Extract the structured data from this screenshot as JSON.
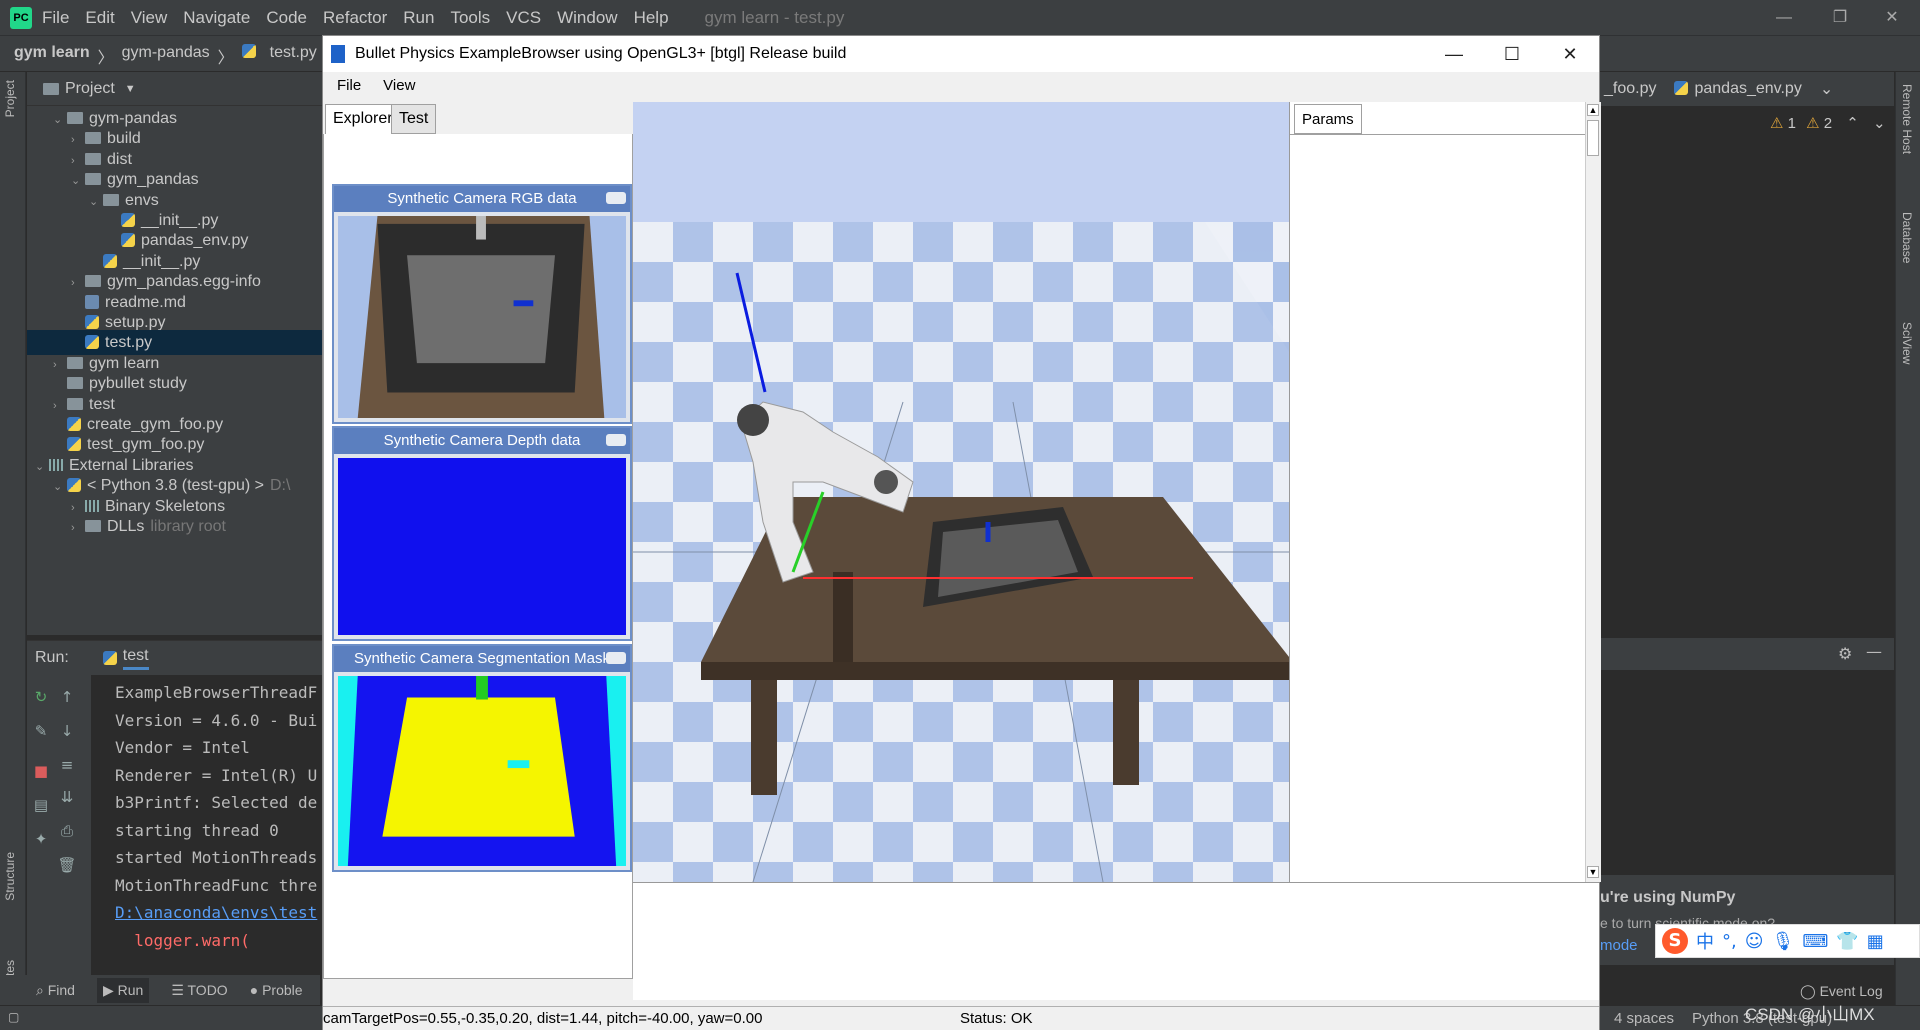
{
  "ide": {
    "menu": [
      "File",
      "Edit",
      "View",
      "Navigate",
      "Code",
      "Refactor",
      "Run",
      "Tools",
      "VCS",
      "Window",
      "Help"
    ],
    "title": "gym learn - test.py",
    "breadcrumbs": [
      "gym learn",
      "gym-pandas",
      "test.py"
    ],
    "project_label": "Project",
    "tree": [
      {
        "label": "gym-pandas",
        "indent": 1,
        "type": "folder",
        "arrow": "v"
      },
      {
        "label": "build",
        "indent": 2,
        "type": "folder",
        "arrow": ">"
      },
      {
        "label": "dist",
        "indent": 2,
        "type": "folder",
        "arrow": ">"
      },
      {
        "label": "gym_pandas",
        "indent": 2,
        "type": "folder",
        "arrow": "v"
      },
      {
        "label": "envs",
        "indent": 3,
        "type": "folder",
        "arrow": "v"
      },
      {
        "label": "__init__.py",
        "indent": 4,
        "type": "py",
        "arrow": ""
      },
      {
        "label": "pandas_env.py",
        "indent": 4,
        "type": "py",
        "arrow": ""
      },
      {
        "label": "__init__.py",
        "indent": 3,
        "type": "py",
        "arrow": ""
      },
      {
        "label": "gym_pandas.egg-info",
        "indent": 2,
        "type": "folder",
        "arrow": ">"
      },
      {
        "label": "readme.md",
        "indent": 2,
        "type": "md",
        "arrow": ""
      },
      {
        "label": "setup.py",
        "indent": 2,
        "type": "py",
        "arrow": ""
      },
      {
        "label": "test.py",
        "indent": 2,
        "type": "py",
        "arrow": "",
        "selected": true
      },
      {
        "label": "gym learn",
        "indent": 1,
        "type": "folder",
        "arrow": ">"
      },
      {
        "label": "pybullet study",
        "indent": 1,
        "type": "folder",
        "arrow": ""
      },
      {
        "label": "test",
        "indent": 1,
        "type": "folder",
        "arrow": ">"
      },
      {
        "label": "create_gym_foo.py",
        "indent": 1,
        "type": "py",
        "arrow": ""
      },
      {
        "label": "test_gym_foo.py",
        "indent": 1,
        "type": "py",
        "arrow": ""
      },
      {
        "label": "External Libraries",
        "indent": 0,
        "type": "lib",
        "arrow": "v"
      },
      {
        "label": "< Python 3.8 (test-gpu) >",
        "suffix": "D:\\",
        "indent": 1,
        "type": "py",
        "arrow": "v"
      },
      {
        "label": "Binary Skeletons",
        "indent": 2,
        "type": "lib",
        "arrow": ">"
      },
      {
        "label": "DLLs",
        "suffix": "library root",
        "indent": 2,
        "type": "folder",
        "arrow": ">"
      }
    ],
    "run_label": "Run:",
    "run_tab": "test",
    "console": [
      {
        "text": "ExampleBrowserThreadF",
        "cls": ""
      },
      {
        "text": "Version = 4.6.0 - Bui",
        "cls": ""
      },
      {
        "text": "Vendor = Intel",
        "cls": ""
      },
      {
        "text": "Renderer = Intel(R) U",
        "cls": ""
      },
      {
        "text": "b3Printf: Selected de",
        "cls": ""
      },
      {
        "text": "starting thread 0",
        "cls": ""
      },
      {
        "text": "started MotionThreads",
        "cls": ""
      },
      {
        "text": "MotionThreadFunc thre",
        "cls": ""
      },
      {
        "text": "D:\\anaconda\\envs\\test",
        "cls": "link"
      },
      {
        "text": "  logger.warn(",
        "cls": "err"
      }
    ],
    "bottom_tabs": [
      "Find",
      "Run",
      "TODO",
      "Proble"
    ],
    "right_tabs": [
      "_foo.py",
      "pandas_env.py"
    ],
    "warnings": [
      "1",
      "2"
    ],
    "right_strip": [
      "Remote Host",
      "Database",
      "SciView"
    ],
    "left_strip": [
      "Project",
      "Structure",
      "Favorites"
    ],
    "numpy_title": "u're using NumPy",
    "numpy_text": "e to turn scientific mode on?",
    "numpy_link": "mode",
    "event_log": "Event Log",
    "status_right": [
      "4 spaces",
      "Python 3.8 (test-gpu)"
    ],
    "watermark": "CSDN @小山MX"
  },
  "bullet": {
    "title": "Bullet Physics ExampleBrowser using OpenGL3+ [btgl] Release build",
    "menu": [
      "File",
      "View"
    ],
    "tabs": [
      "Explorer",
      "Test"
    ],
    "params_tab": "Params",
    "cam_rgb": "Synthetic Camera RGB data",
    "cam_depth": "Synthetic Camera Depth data",
    "cam_seg": "Synthetic Camera Segmentation Mask",
    "status_cam": "camTargetPos=0.55,-0.35,0.20, dist=1.44, pitch=-40.00, yaw=0.00",
    "status_ok": "Status: OK"
  }
}
